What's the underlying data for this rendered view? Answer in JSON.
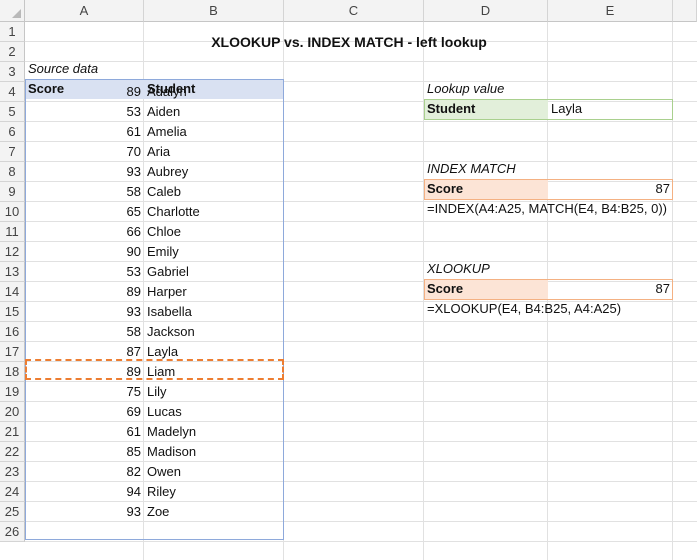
{
  "columns": [
    "A",
    "B",
    "C",
    "D",
    "E"
  ],
  "rows": [
    "1",
    "2",
    "3",
    "4",
    "5",
    "6",
    "7",
    "8",
    "9",
    "10",
    "11",
    "12",
    "13",
    "14",
    "15",
    "16",
    "17",
    "18",
    "19",
    "20",
    "21",
    "22",
    "23",
    "24",
    "25",
    "26"
  ],
  "title": "XLOOKUP vs. INDEX MATCH - left lookup",
  "source_label": "Source data",
  "table": {
    "headers": [
      "Score",
      "Student"
    ],
    "scores": [
      "89",
      "53",
      "61",
      "70",
      "93",
      "58",
      "65",
      "66",
      "90",
      "53",
      "89",
      "93",
      "58",
      "87",
      "89",
      "75",
      "69",
      "61",
      "85",
      "82",
      "94",
      "93"
    ],
    "students": [
      "Adalyn",
      "Aiden",
      "Amelia",
      "Aria",
      "Aubrey",
      "Caleb",
      "Charlotte",
      "Chloe",
      "Emily",
      "Gabriel",
      "Harper",
      "Isabella",
      "Jackson",
      "Layla",
      "Liam",
      "Lily",
      "Lucas",
      "Madelyn",
      "Madison",
      "Owen",
      "Riley",
      "Zoe"
    ]
  },
  "lookup": {
    "heading": "Lookup value",
    "label": "Student",
    "value": "Layla"
  },
  "index_match": {
    "heading": "INDEX MATCH",
    "label": "Score",
    "value": "87",
    "formula": "=INDEX(A4:A25, MATCH(E4, B4:B25, 0))"
  },
  "xlookup": {
    "heading": "XLOOKUP",
    "label": "Score",
    "value": "87",
    "formula": "=XLOOKUP(E4, B4:B25, A4:A25)"
  },
  "colors": {
    "header_fill": "#d9e1f2",
    "lookup_fill": "#e2efda",
    "result_fill": "#fce4d6",
    "highlight_border": "#ed7d31",
    "table_border": "#8ea9db"
  }
}
